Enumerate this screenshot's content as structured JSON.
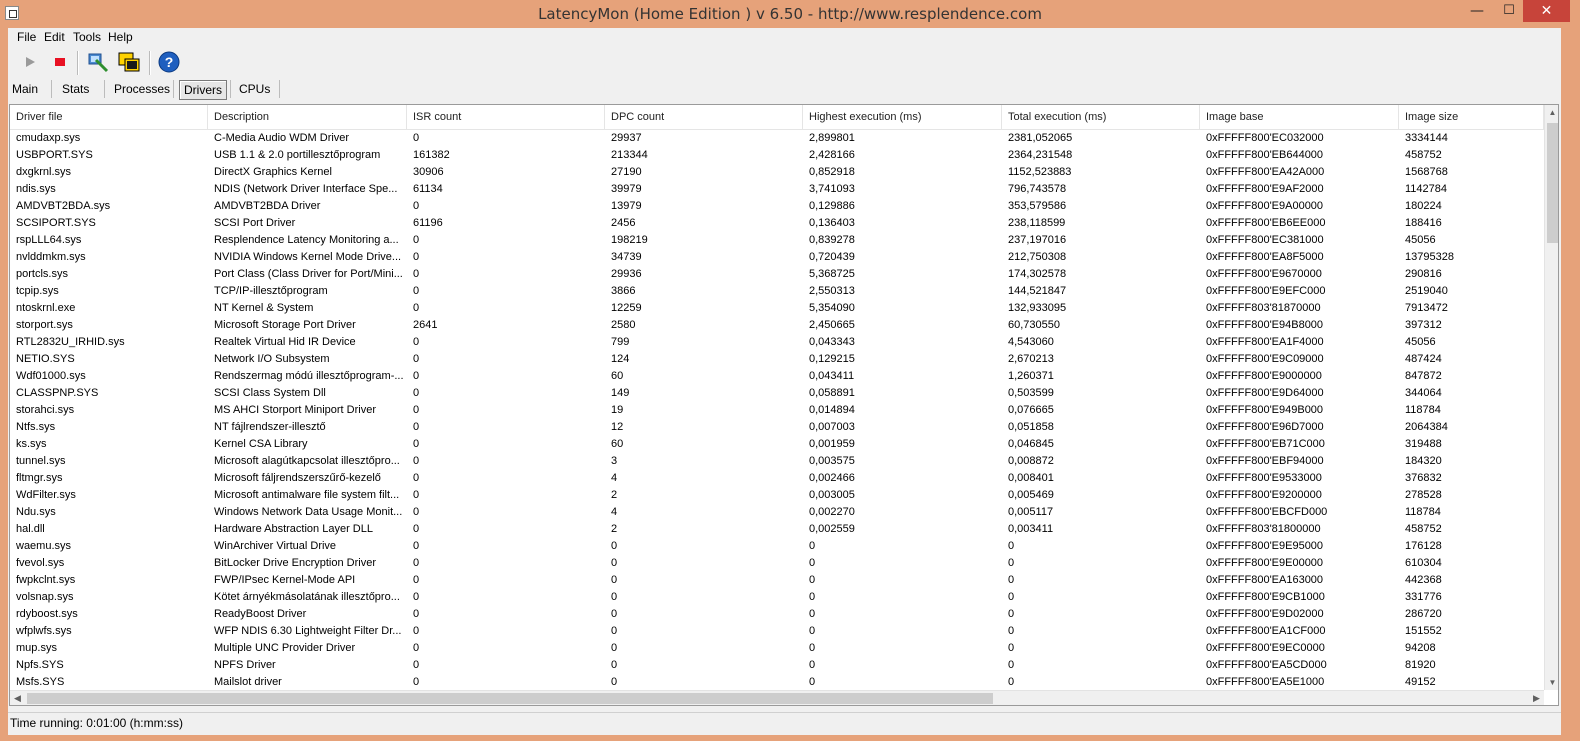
{
  "window": {
    "title": "LatencyMon  (Home Edition )  v 6.50 - http://www.resplendence.com",
    "buttons": {
      "minimize": "—",
      "maximize": "☐",
      "close": "✕"
    }
  },
  "menu": [
    "File",
    "Edit",
    "Tools",
    "Help"
  ],
  "toolbar": {
    "icons": [
      "play-icon",
      "stop-icon",
      "tools-icon",
      "windows-icon",
      "help-icon"
    ]
  },
  "tabs": [
    "Main",
    "Stats",
    "Processes",
    "Drivers",
    "CPUs"
  ],
  "active_tab": "Drivers",
  "table": {
    "columns": [
      "Driver file",
      "Description",
      "ISR count",
      "DPC count",
      "Highest execution (ms)",
      "Total execution (ms)",
      "Image base",
      "Image size"
    ],
    "rows": [
      [
        "cmudaxp.sys",
        "C-Media Audio WDM Driver",
        "0",
        "29937",
        "2,899801",
        "2381,052065",
        "0xFFFFF800'EC032000",
        "3334144"
      ],
      [
        "USBPORT.SYS",
        "USB 1.1 & 2.0 portillesztőprogram",
        "161382",
        "213344",
        "2,428166",
        "2364,231548",
        "0xFFFFF800'EB644000",
        "458752"
      ],
      [
        "dxgkrnl.sys",
        "DirectX Graphics Kernel",
        "30906",
        "27190",
        "0,852918",
        "1152,523883",
        "0xFFFFF800'EA42A000",
        "1568768"
      ],
      [
        "ndis.sys",
        "NDIS (Network Driver Interface Spe...",
        "61134",
        "39979",
        "3,741093",
        "796,743578",
        "0xFFFFF800'E9AF2000",
        "1142784"
      ],
      [
        "AMDVBT2BDA.sys",
        "AMDVBT2BDA Driver",
        "0",
        "13979",
        "0,129886",
        "353,579586",
        "0xFFFFF800'E9A00000",
        "180224"
      ],
      [
        "SCSIPORT.SYS",
        "SCSI Port Driver",
        "61196",
        "2456",
        "0,136403",
        "238,118599",
        "0xFFFFF800'EB6EE000",
        "188416"
      ],
      [
        "rspLLL64.sys",
        "Resplendence Latency Monitoring a...",
        "0",
        "198219",
        "0,839278",
        "237,197016",
        "0xFFFFF800'EC381000",
        "45056"
      ],
      [
        "nvlddmkm.sys",
        "NVIDIA Windows Kernel Mode Drive...",
        "0",
        "34739",
        "0,720439",
        "212,750308",
        "0xFFFFF800'EA8F5000",
        "13795328"
      ],
      [
        "portcls.sys",
        "Port Class (Class Driver for Port/Mini...",
        "0",
        "29936",
        "5,368725",
        "174,302578",
        "0xFFFFF800'E9670000",
        "290816"
      ],
      [
        "tcpip.sys",
        "TCP/IP-illesztőprogram",
        "0",
        "3866",
        "2,550313",
        "144,521847",
        "0xFFFFF800'E9EFC000",
        "2519040"
      ],
      [
        "ntoskrnl.exe",
        "NT Kernel & System",
        "0",
        "12259",
        "5,354090",
        "132,933095",
        "0xFFFFF803'81870000",
        "7913472"
      ],
      [
        "storport.sys",
        "Microsoft Storage Port Driver",
        "2641",
        "2580",
        "2,450665",
        "60,730550",
        "0xFFFFF800'E94B8000",
        "397312"
      ],
      [
        "RTL2832U_IRHID.sys",
        "Realtek Virtual Hid IR Device",
        "0",
        "799",
        "0,043343",
        "4,543060",
        "0xFFFFF800'EA1F4000",
        "45056"
      ],
      [
        "NETIO.SYS",
        "Network I/O Subsystem",
        "0",
        "124",
        "0,129215",
        "2,670213",
        "0xFFFFF800'E9C09000",
        "487424"
      ],
      [
        "Wdf01000.sys",
        "Rendszermag módú illesztőprogram-...",
        "0",
        "60",
        "0,043411",
        "1,260371",
        "0xFFFFF800'E9000000",
        "847872"
      ],
      [
        "CLASSPNP.SYS",
        "SCSI Class System Dll",
        "0",
        "149",
        "0,058891",
        "0,503599",
        "0xFFFFF800'E9D64000",
        "344064"
      ],
      [
        "storahci.sys",
        "MS AHCI Storport Miniport Driver",
        "0",
        "19",
        "0,014894",
        "0,076665",
        "0xFFFFF800'E949B000",
        "118784"
      ],
      [
        "Ntfs.sys",
        "NT fájlrendszer-illesztő",
        "0",
        "12",
        "0,007003",
        "0,051858",
        "0xFFFFF800'E96D7000",
        "2064384"
      ],
      [
        "ks.sys",
        "Kernel CSA Library",
        "0",
        "60",
        "0,001959",
        "0,046845",
        "0xFFFFF800'EB71C000",
        "319488"
      ],
      [
        "tunnel.sys",
        "Microsoft alagútkapcsolat illesztőpro...",
        "0",
        "3",
        "0,003575",
        "0,008872",
        "0xFFFFF800'EBF94000",
        "184320"
      ],
      [
        "fltmgr.sys",
        "Microsoft fáljrendszerszűrő-kezelő",
        "0",
        "4",
        "0,002466",
        "0,008401",
        "0xFFFFF800'E9533000",
        "376832"
      ],
      [
        "WdFilter.sys",
        "Microsoft antimalware file system filt...",
        "0",
        "2",
        "0,003005",
        "0,005469",
        "0xFFFFF800'E9200000",
        "278528"
      ],
      [
        "Ndu.sys",
        "Windows Network Data Usage Monit...",
        "0",
        "4",
        "0,002270",
        "0,005117",
        "0xFFFFF800'EBCFD000",
        "118784"
      ],
      [
        "hal.dll",
        "Hardware Abstraction Layer DLL",
        "0",
        "2",
        "0,002559",
        "0,003411",
        "0xFFFFF803'81800000",
        "458752"
      ],
      [
        "waemu.sys",
        "WinArchiver Virtual Drive",
        "0",
        "0",
        "0",
        "0",
        "0xFFFFF800'E9E95000",
        "176128"
      ],
      [
        "fvevol.sys",
        "BitLocker Drive Encryption Driver",
        "0",
        "0",
        "0",
        "0",
        "0xFFFFF800'E9E00000",
        "610304"
      ],
      [
        "fwpkclnt.sys",
        "FWP/IPsec Kernel-Mode API",
        "0",
        "0",
        "0",
        "0",
        "0xFFFFF800'EA163000",
        "442368"
      ],
      [
        "volsnap.sys",
        "Kötet árnyékmásolatának illesztőpro...",
        "0",
        "0",
        "0",
        "0",
        "0xFFFFF800'E9CB1000",
        "331776"
      ],
      [
        "rdyboost.sys",
        "ReadyBoost Driver",
        "0",
        "0",
        "0",
        "0",
        "0xFFFFF800'E9D02000",
        "286720"
      ],
      [
        "wfplwfs.sys",
        "WFP NDIS 6.30 Lightweight Filter Dr...",
        "0",
        "0",
        "0",
        "0",
        "0xFFFFF800'EA1CF000",
        "151552"
      ],
      [
        "mup.sys",
        "Multiple UNC Provider Driver",
        "0",
        "0",
        "0",
        "0",
        "0xFFFFF800'E9EC0000",
        "94208"
      ],
      [
        "Npfs.SYS",
        "NPFS Driver",
        "0",
        "0",
        "0",
        "0",
        "0xFFFFF800'EA5CD000",
        "81920"
      ],
      [
        "Msfs.SYS",
        "Mailslot driver",
        "0",
        "0",
        "0",
        "0",
        "0xFFFFF800'EA5E1000",
        "49152"
      ]
    ]
  },
  "status": "Time running: 0:01:00  (h:mm:ss)",
  "colors": {
    "titlebar": "#e6a27a",
    "close_button": "#c7443a",
    "stop_red": "#e81123",
    "help_blue": "#1f5fbf"
  }
}
